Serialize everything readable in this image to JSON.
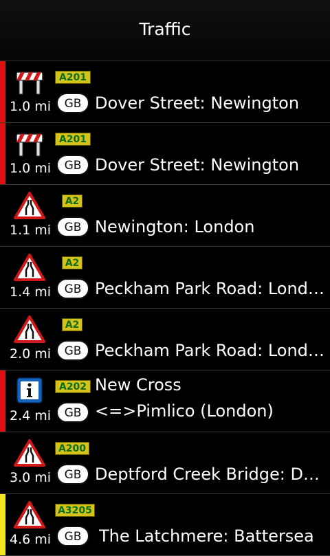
{
  "header": {
    "title": "Traffic"
  },
  "colors": {
    "red": "#e01010",
    "yellow": "#f2e61a"
  },
  "incidents": [
    {
      "icon": "roadworks-icon",
      "road": "A201",
      "distance": "1.0 mi",
      "country": "GB",
      "title": "Dover Street: Newington",
      "bar": "red"
    },
    {
      "icon": "roadworks-icon",
      "road": "A201",
      "distance": "1.0 mi",
      "country": "GB",
      "title": "Dover Street: Newington",
      "bar": "red"
    },
    {
      "icon": "road-narrows-icon",
      "road": "A2",
      "distance": "1.1 mi",
      "country": "GB",
      "title": "Newington: London",
      "bar": "none"
    },
    {
      "icon": "road-narrows-icon",
      "road": "A2",
      "distance": "1.4 mi",
      "country": "GB",
      "title": "Peckham Park Road: Lond…",
      "bar": "none"
    },
    {
      "icon": "road-narrows-icon",
      "road": "A2",
      "distance": "2.0 mi",
      "country": "GB",
      "title": "Peckham Park Road: Lond…",
      "bar": "none"
    },
    {
      "icon": "info-icon",
      "road": "A202",
      "distance": "2.4 mi",
      "country": "GB",
      "title": "New Cross",
      "title2": "<=>Pimlico (London)",
      "bar": "red"
    },
    {
      "icon": "road-narrows-icon",
      "road": "A200",
      "distance": "3.0 mi",
      "country": "GB",
      "title": "Deptford Creek Bridge: D…",
      "bar": "none"
    },
    {
      "icon": "road-narrows-icon",
      "road": "A3205",
      "distance": "4.6 mi",
      "country": "GB",
      "title": "The Latchmere: Battersea",
      "bar": "yellow"
    }
  ]
}
